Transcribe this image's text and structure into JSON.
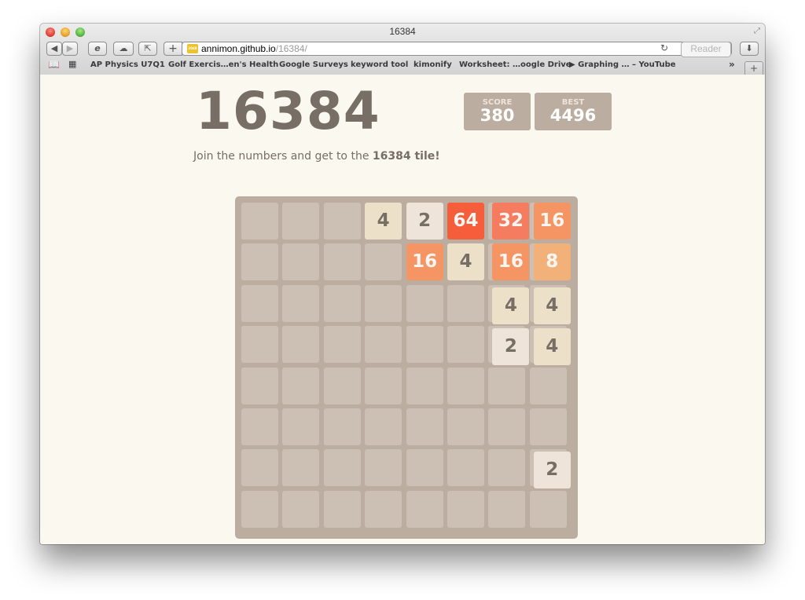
{
  "browser": {
    "window_title": "16384",
    "url_host": "annimon.github.io",
    "url_path": "/16384/",
    "reader_label": "Reader",
    "favicon_text": "2048",
    "bookmarks": [
      "AP Physics U7Q1",
      "Golf Exercis…en's Health",
      "Google Surveys",
      "keyword tool",
      "kimonify",
      "Worksheet: …oogle Drive",
      "▶ Graphing … – YouTube"
    ],
    "overflow_label": "»",
    "new_tab_label": "+"
  },
  "game": {
    "title": "16384",
    "score_label": "SCORE",
    "score": "380",
    "best_label": "BEST",
    "best": "4496",
    "intro_prefix": "Join the numbers and get to the ",
    "intro_bold": "16384 tile!",
    "grid_size": 8,
    "tiles": [
      {
        "row": 0,
        "col": 3,
        "value": "4"
      },
      {
        "row": 0,
        "col": 4,
        "value": "2"
      },
      {
        "row": 0,
        "col": 5,
        "value": "64"
      },
      {
        "row": 0,
        "col": 6,
        "value": "32"
      },
      {
        "row": 0,
        "col": 7,
        "value": "16"
      },
      {
        "row": 1,
        "col": 4,
        "value": "16"
      },
      {
        "row": 1,
        "col": 5,
        "value": "4"
      },
      {
        "row": 1,
        "col": 6,
        "value": "16"
      },
      {
        "row": 1,
        "col": 7,
        "value": "8"
      },
      {
        "row": 2,
        "col": 6,
        "value": "4"
      },
      {
        "row": 2,
        "col": 7,
        "value": "4"
      },
      {
        "row": 3,
        "col": 6,
        "value": "2"
      },
      {
        "row": 3,
        "col": 7,
        "value": "4"
      },
      {
        "row": 6,
        "col": 7,
        "value": "2"
      }
    ],
    "tile_colors": {
      "2": {
        "bg": "#eee4da",
        "fg": "#776e65"
      },
      "4": {
        "bg": "#ede0c8",
        "fg": "#776e65"
      },
      "8": {
        "bg": "#f2b179",
        "fg": "#f9f6f2"
      },
      "16": {
        "bg": "#f59563",
        "fg": "#f9f6f2"
      },
      "32": {
        "bg": "#f67c5f",
        "fg": "#f9f6f2"
      },
      "64": {
        "bg": "#f65e3b",
        "fg": "#f9f6f2"
      }
    }
  }
}
